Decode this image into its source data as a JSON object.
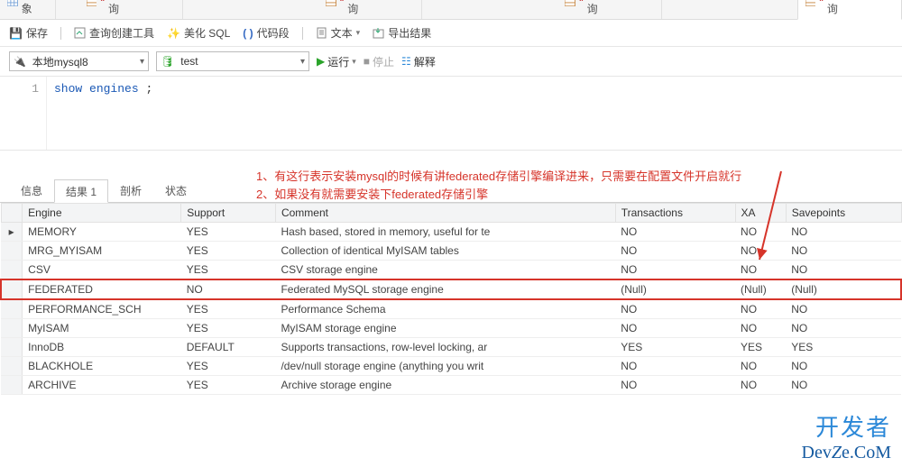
{
  "tabs": {
    "objects": "对象",
    "query1": "无标题 - 查询",
    "query2": "无标题 - 查询",
    "query3": "无标题 - 查询",
    "query_active": "无标题 - 查询"
  },
  "toolbar": {
    "save": "保存",
    "builder": "查询创建工具",
    "beautify": "美化 SQL",
    "snippets": "代码段",
    "text": "文本",
    "export": "导出结果"
  },
  "connbar": {
    "connection": "本地mysql8",
    "database": "test",
    "run": "运行",
    "stop": "停止",
    "explain": "解释"
  },
  "editor": {
    "line_no": "1",
    "sql_kw1": "show",
    "sql_kw2": "engines",
    "sql_tail": " ;"
  },
  "annotation": {
    "line1": "1、有这行表示安装mysql的时候有讲federated存储引擎编译进来，只需要在配置文件开启就行",
    "line2": "2、如果没有就需要安装下federated存储引擎"
  },
  "result_tabs": {
    "info": "信息",
    "result": "结果 1",
    "profile": "剖析",
    "status": "状态"
  },
  "columns": {
    "engine": "Engine",
    "support": "Support",
    "comment": "Comment",
    "transactions": "Transactions",
    "xa": "XA",
    "savepoints": "Savepoints"
  },
  "rows": [
    {
      "engine": "MEMORY",
      "support": "YES",
      "comment": "Hash based, stored in memory, useful for te",
      "transactions": "NO",
      "xa": "NO",
      "savepoints": "NO",
      "mark": "▸"
    },
    {
      "engine": "MRG_MYISAM",
      "support": "YES",
      "comment": "Collection of identical MyISAM tables",
      "transactions": "NO",
      "xa": "NO",
      "savepoints": "NO"
    },
    {
      "engine": "CSV",
      "support": "YES",
      "comment": "CSV storage engine",
      "transactions": "NO",
      "xa": "NO",
      "savepoints": "NO"
    },
    {
      "engine": "FEDERATED",
      "support": "NO",
      "comment": "Federated MySQL storage engine",
      "transactions": "(Null)",
      "xa": "(Null)",
      "savepoints": "(Null)",
      "null": true,
      "boxed": true
    },
    {
      "engine": "PERFORMANCE_SCH",
      "support": "YES",
      "comment": "Performance Schema",
      "transactions": "NO",
      "xa": "NO",
      "savepoints": "NO"
    },
    {
      "engine": "MyISAM",
      "support": "YES",
      "comment": "MyISAM storage engine",
      "transactions": "NO",
      "xa": "NO",
      "savepoints": "NO"
    },
    {
      "engine": "InnoDB",
      "support": "DEFAULT",
      "comment": "Supports transactions, row-level locking, ar",
      "transactions": "YES",
      "xa": "YES",
      "savepoints": "YES"
    },
    {
      "engine": "BLACKHOLE",
      "support": "YES",
      "comment": "/dev/null storage engine (anything you writ",
      "transactions": "NO",
      "xa": "NO",
      "savepoints": "NO"
    },
    {
      "engine": "ARCHIVE",
      "support": "YES",
      "comment": "Archive storage engine",
      "transactions": "NO",
      "xa": "NO",
      "savepoints": "NO"
    }
  ],
  "watermark": {
    "line1": "开发者",
    "line2a": "Dev",
    "line2b": "Z",
    "line2c": "e",
    "line2d": ".CoM"
  }
}
